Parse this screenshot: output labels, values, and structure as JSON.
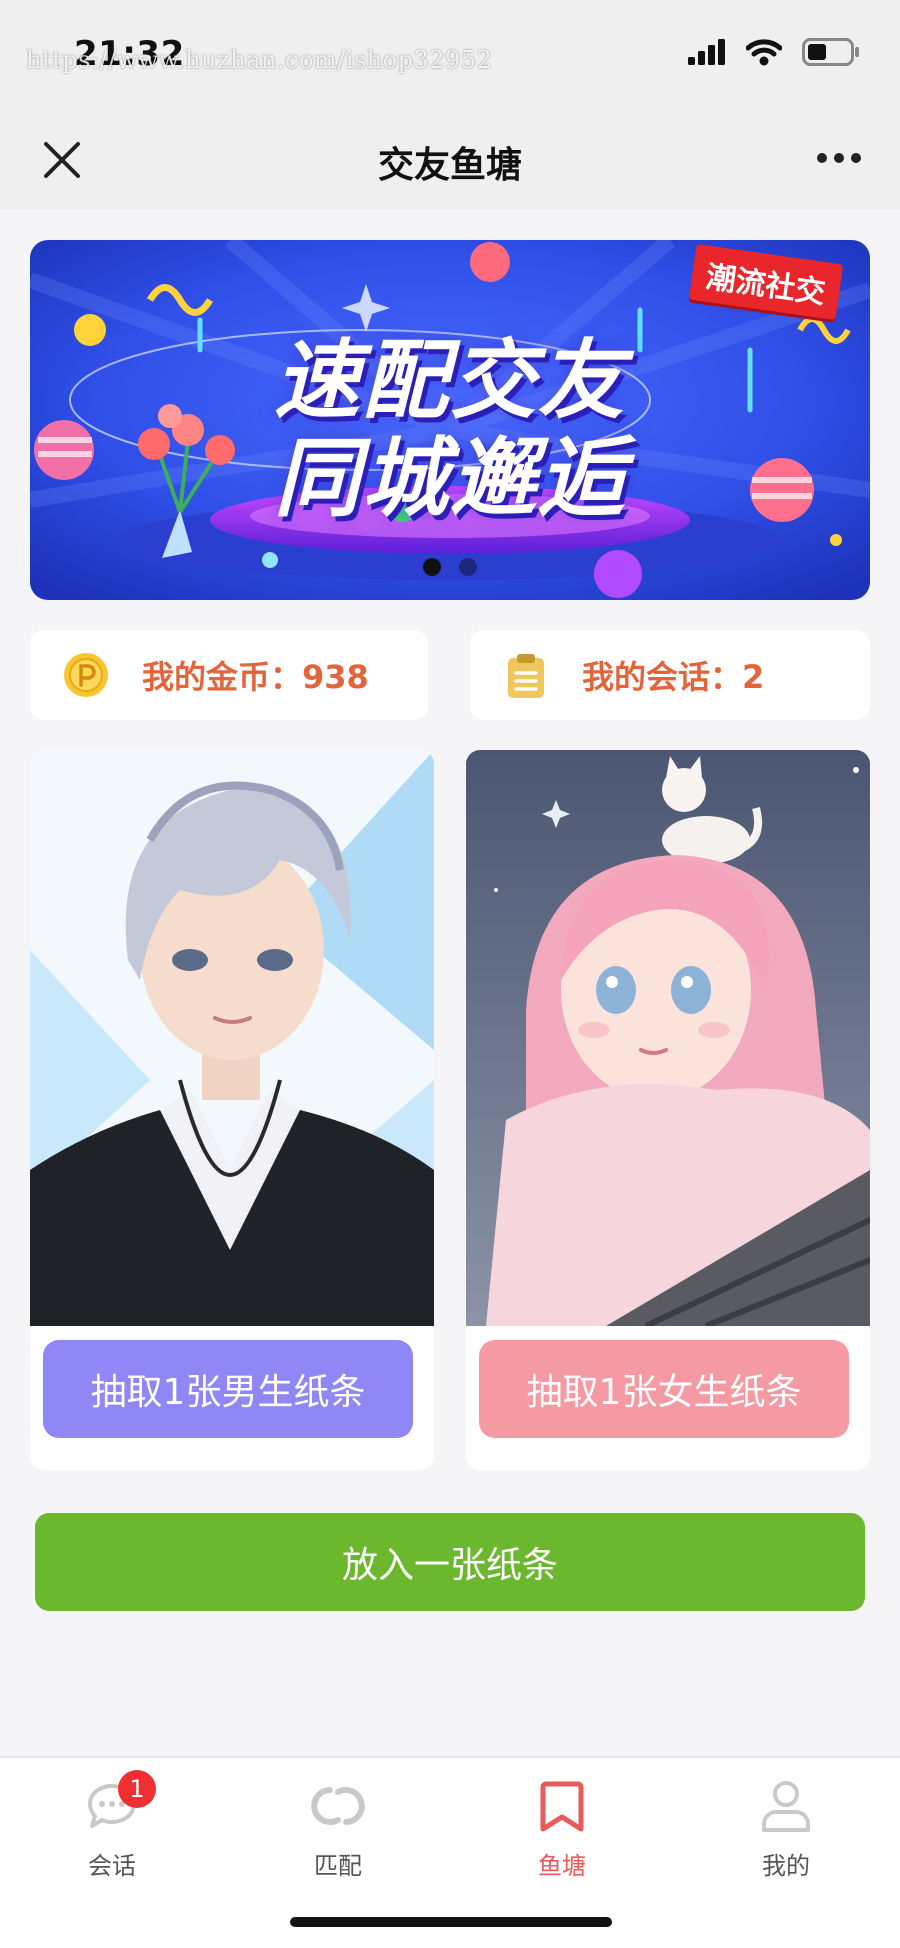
{
  "status_bar": {
    "time": "21:32",
    "watermark": "https://www.huzhan.com/ishop32952",
    "icons": [
      "signal-icon",
      "wifi-icon",
      "battery-icon"
    ]
  },
  "nav": {
    "title": "交友鱼塘",
    "close_icon": "close-icon",
    "more_icon": "more-icon"
  },
  "banner": {
    "line1": "速配交友",
    "line2": "同城邂逅",
    "tag": "潮流社交",
    "page_count": 2,
    "active_page": 1
  },
  "stats": {
    "coins_label": "我的金币：938",
    "chats_label": "我的会话：2",
    "coins_icon": "coin-icon",
    "chats_icon": "clipboard-icon",
    "accent_color": "#e3643a"
  },
  "cards": {
    "male_button": "抽取1张男生纸条",
    "female_button": "抽取1张女生纸条",
    "male_color": "#8e87f5",
    "female_color": "#f59aa3"
  },
  "put_button": {
    "label": "放入一张纸条",
    "color": "#6bb72e"
  },
  "tabbar": {
    "items": [
      {
        "label": "会话",
        "icon": "chat-bubble-icon",
        "badge": "1"
      },
      {
        "label": "匹配",
        "icon": "match-swirl-icon"
      },
      {
        "label": "鱼塘",
        "icon": "bookmark-icon"
      },
      {
        "label": "我的",
        "icon": "user-icon"
      }
    ],
    "active_index": 2,
    "active_color": "#ea5a5a"
  }
}
